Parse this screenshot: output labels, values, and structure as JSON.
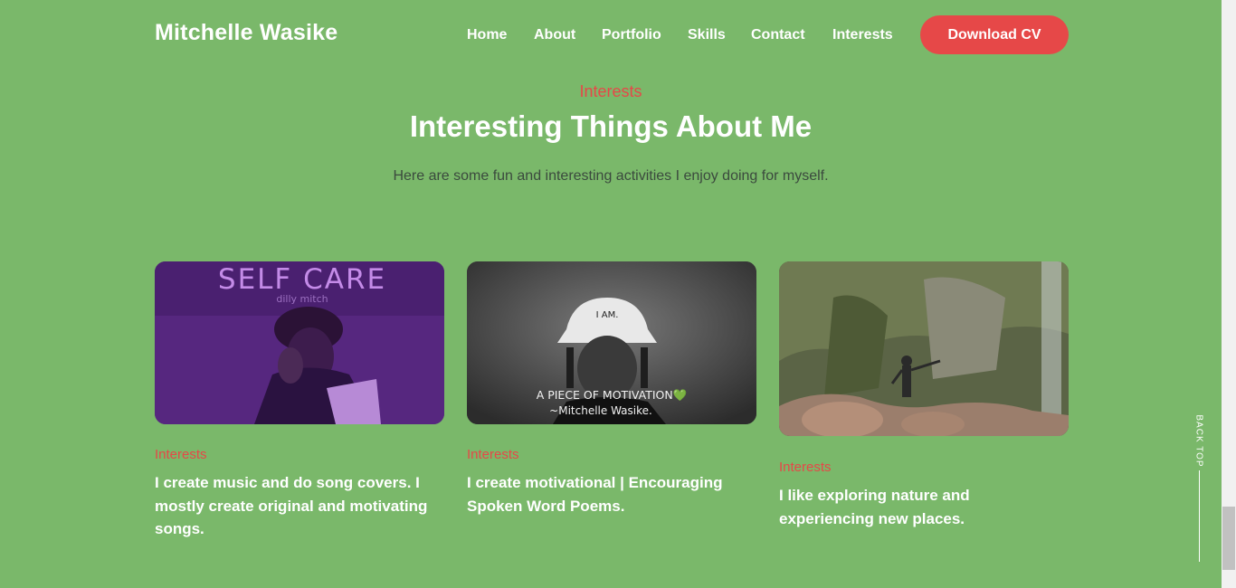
{
  "brand": {
    "name": "Mitchelle Wasike"
  },
  "nav": {
    "items": [
      {
        "label": "Home"
      },
      {
        "label": "About"
      },
      {
        "label": "Portfolio"
      },
      {
        "label": "Skills"
      },
      {
        "label": "Contact"
      },
      {
        "label": "Interests"
      }
    ],
    "cta": "Download CV"
  },
  "section": {
    "eyebrow": "Interests",
    "heading": "Interesting Things About Me",
    "lead": "Here are some fun and interesting activities I enjoy doing for myself."
  },
  "cards": [
    {
      "tag": "Interests",
      "desc": "I create music and do song covers. I mostly create original and motivating songs.",
      "image": {
        "title": "SELF CARE",
        "subtitle": "dilly mitch"
      }
    },
    {
      "tag": "Interests",
      "desc": "I create motivational | Encouraging Spoken Word Poems.",
      "image": {
        "hat_text": "I AM.",
        "caption": "A PIECE OF MOTIVATION💚",
        "caption_sub": "~Mitchelle Wasike."
      }
    },
    {
      "tag": "Interests",
      "desc": "I like exploring nature and experiencing new places."
    }
  ],
  "back_top": "BACK TOP",
  "colors": {
    "background": "#7ab86a",
    "accent": "#e64848"
  }
}
